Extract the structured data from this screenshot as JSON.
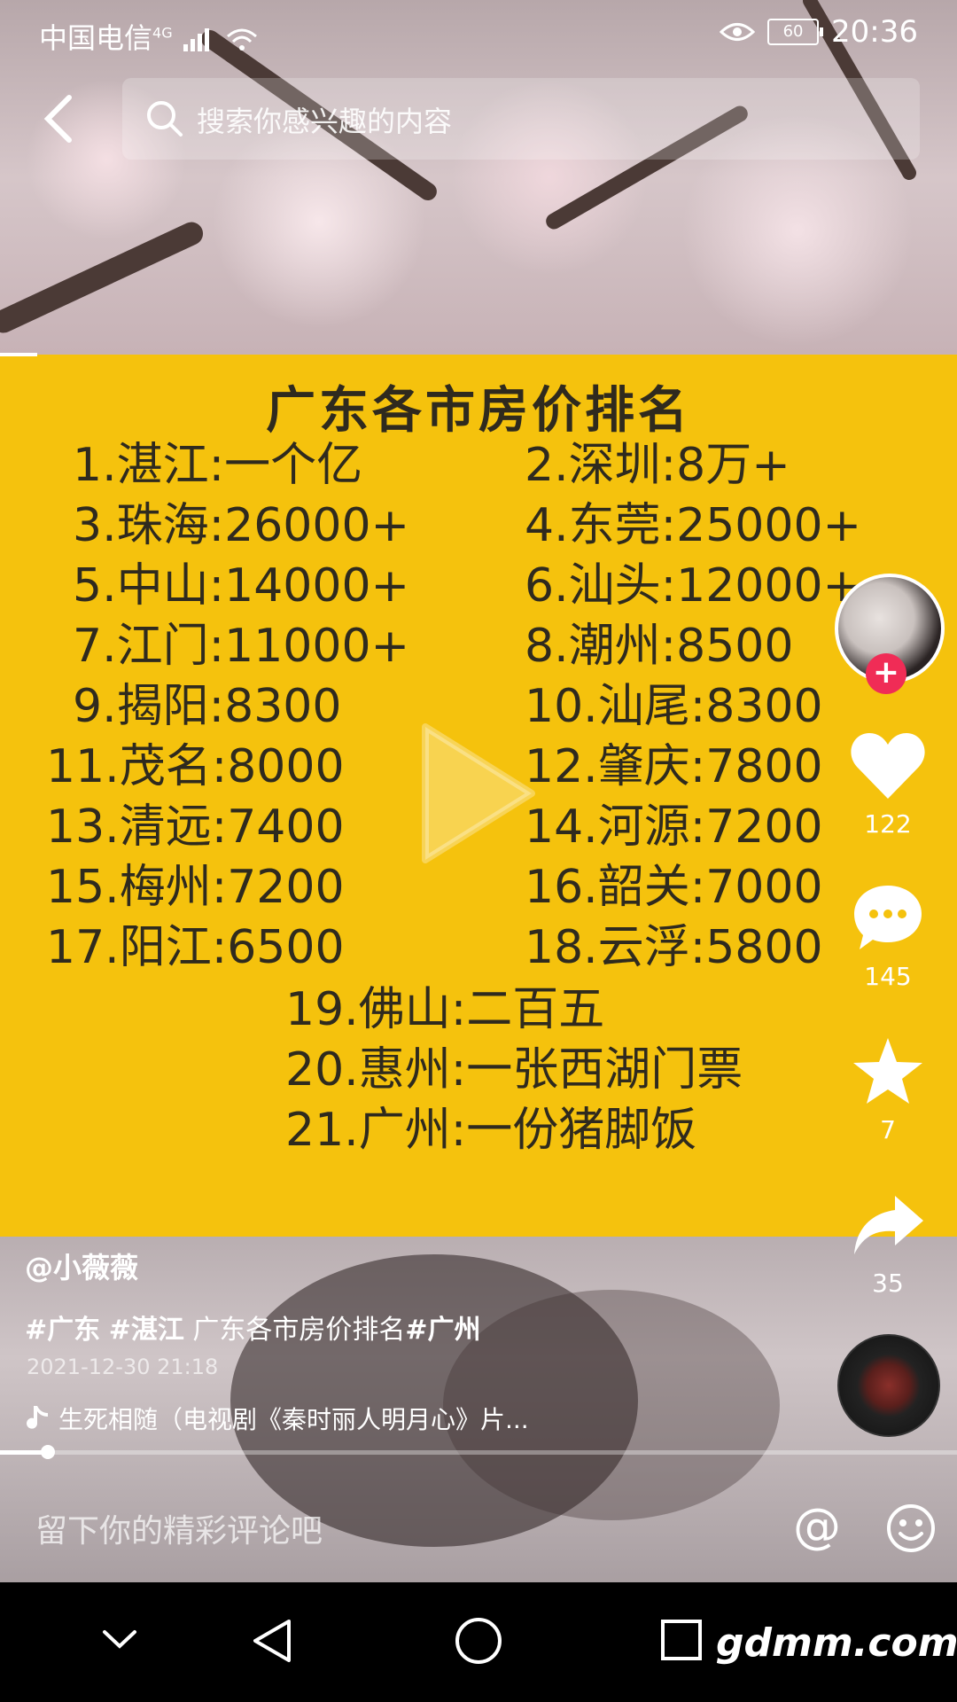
{
  "status_bar": {
    "carrier": "中国电信",
    "network": "4G",
    "battery": "60",
    "time": "20:36"
  },
  "search": {
    "placeholder": "搜索你感兴趣的内容",
    "icon": "search-icon"
  },
  "card": {
    "title": "广东各市房价排名",
    "rows": [
      {
        "left": "1.湛江:一个亿",
        "right": "2.深圳:8万+"
      },
      {
        "left": "3.珠海:26000+",
        "right": "4.东莞:25000+"
      },
      {
        "left": "5.中山:14000+",
        "right": "6.汕头:12000+"
      },
      {
        "left": "7.江门:11000+",
        "right": "8.潮州:8500"
      },
      {
        "left": "9.揭阳:8300",
        "right": "10.汕尾:8300"
      },
      {
        "left": "11.茂名:8000",
        "right": "12.肇庆:7800"
      },
      {
        "left": "13.清远:7400",
        "right": "14.河源:7200"
      },
      {
        "left": "15.梅州:7200",
        "right": "16.韶关:7000"
      },
      {
        "left": "17.阳江:6500",
        "right": "18.云浮:5800"
      }
    ],
    "center_rows": [
      "19.佛山:二百五",
      "20.惠州:一张西湖门票",
      "21.广州:一份猪脚饭"
    ],
    "color": "#f5c20d"
  },
  "actions": {
    "likes": "122",
    "comments": "145",
    "favorites": "7",
    "shares": "35"
  },
  "post": {
    "author": "@小薇薇",
    "tag1": "#广东",
    "tag2": "#湛江",
    "caption_text": "广东各市房价排名",
    "tag3": "#广州",
    "date": "2021-12-30 21:18",
    "music": "生死相随（电视剧《秦时丽人明月心》片..."
  },
  "progress": {
    "fraction": 0.05
  },
  "comment": {
    "placeholder": "留下你的精彩评论吧",
    "at_symbol": "@"
  },
  "watermark": "gdmm.com",
  "colors": {
    "accent": "#f02c56"
  }
}
